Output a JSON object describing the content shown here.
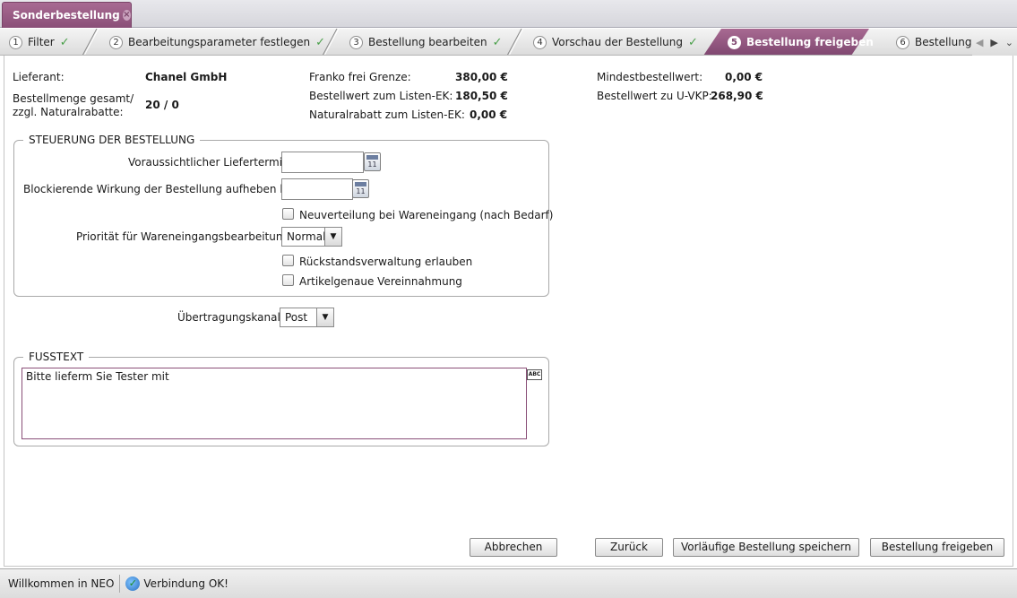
{
  "tab": {
    "title": "Sonderbestellung"
  },
  "steps": [
    {
      "num": "1",
      "label": "Filter",
      "done": true
    },
    {
      "num": "2",
      "label": "Bearbeitungsparameter festlegen",
      "done": true
    },
    {
      "num": "3",
      "label": "Bestellung bearbeiten",
      "done": true
    },
    {
      "num": "4",
      "label": "Vorschau der Bestellung",
      "done": true
    },
    {
      "num": "5",
      "label": "Bestellung freigeben",
      "active": true
    },
    {
      "num": "6",
      "label": "Bestellung a"
    }
  ],
  "info": {
    "lieferant_label": "Lieferant:",
    "lieferant_value": "Chanel GmbH",
    "menge_label_1": "Bestellmenge gesamt/",
    "menge_label_2": "zzgl. Naturalrabatte:",
    "menge_value": "20 / 0",
    "franko_label": "Franko frei Grenze:",
    "franko_value": "380,00 €",
    "listen_ek_label": "Bestellwert zum Listen-EK:",
    "listen_ek_value": "180,50 €",
    "natural_label": "Naturalrabatt zum Listen-EK:",
    "natural_value": "0,00 €",
    "mindest_label": "Mindestbestellwert:",
    "mindest_value": "0,00 €",
    "uvkp_label": "Bestellwert zu U-VKP:",
    "uvkp_value": "268,90 €"
  },
  "steuerung": {
    "legend": "STEUERUNG DER BESTELLUNG",
    "liefertermin_label": "Voraussichtlicher Liefertermin:",
    "liefertermin_value": "",
    "blockierend_label": "Blockierende Wirkung der Bestellung aufheben bis:",
    "blockierend_value": "",
    "neuverteilung_label": "Neuverteilung bei Wareneingang (nach Bedarf)",
    "prioritaet_label": "Priorität für Wareneingangsbearbeitung:",
    "prioritaet_value": "Normal",
    "rueckstand_label": "Rückstandsverwaltung erlauben",
    "artikelgenau_label": "Artikelgenaue Vereinnahmung"
  },
  "kanal": {
    "label": "Übertragungskanal:",
    "value": "Post"
  },
  "fusstext": {
    "legend": "FUSSTEXT",
    "value": "Bitte lieferm Sie Tester mit",
    "spell_icon": "ABC"
  },
  "buttons": {
    "abbrechen": "Abbrechen",
    "zurueck": "Zurück",
    "speichern": "Vorläufige Bestellung speichern",
    "freigeben": "Bestellung freigeben"
  },
  "status": {
    "welcome": "Willkommen in NEO",
    "connection": "Verbindung OK!"
  },
  "colors": {
    "accent": "#8a4f78",
    "check": "#4aa04a"
  }
}
